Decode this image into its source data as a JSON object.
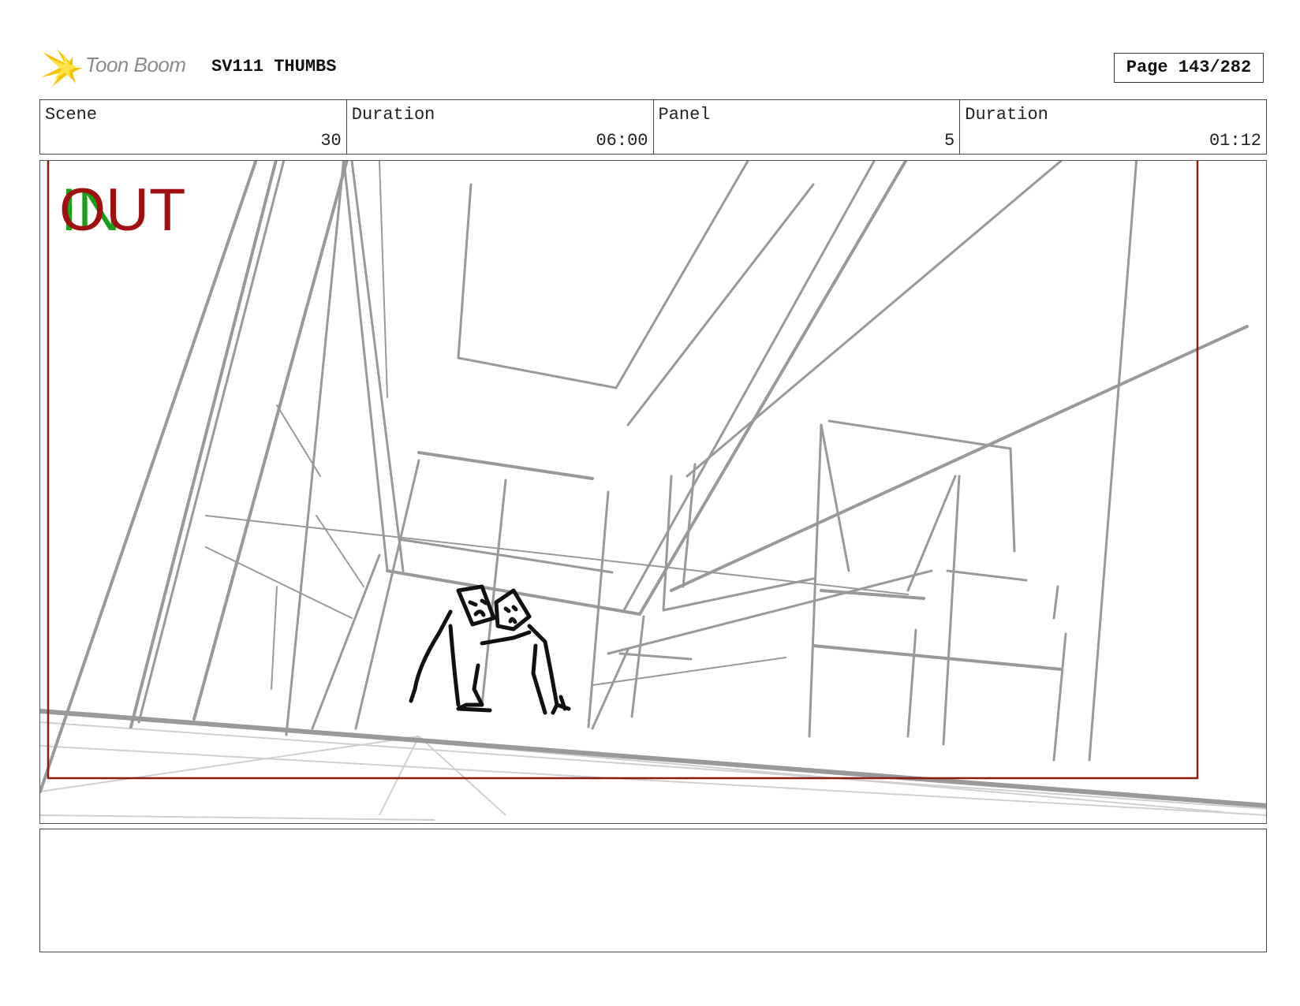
{
  "header": {
    "logo_text": "Toon Boom",
    "title": "SV111 THUMBS",
    "page_label": "Page 143/282"
  },
  "info": {
    "scene_label": "Scene",
    "scene_value": "30",
    "scene_duration_label": "Duration",
    "scene_duration_value": "06:00",
    "panel_label": "Panel",
    "panel_value": "5",
    "panel_duration_label": "Duration",
    "panel_duration_value": "01:12"
  },
  "panel": {
    "in_marker": "IN",
    "out_marker": "OUT",
    "in_color": "#1aa01a",
    "out_color": "#a01010",
    "safe_frame_color": "#8b1a10",
    "sketch_color": "#999999",
    "figure_color": "#111111"
  },
  "notes": {
    "text": ""
  }
}
